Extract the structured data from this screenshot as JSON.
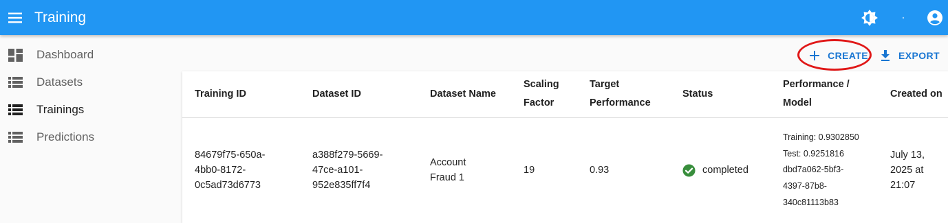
{
  "appbar": {
    "title": "Training",
    "icons": [
      "menu-icon",
      "brightness-icon",
      "more-icon",
      "account-circle-icon"
    ],
    "color": "#2196f3"
  },
  "sidebar": {
    "items": [
      {
        "label": "Dashboard",
        "icon": "dashboard-icon"
      },
      {
        "label": "Datasets",
        "icon": "list-icon"
      },
      {
        "label": "Trainings",
        "icon": "list-icon",
        "active": true
      },
      {
        "label": "Predictions",
        "icon": "list-icon"
      }
    ]
  },
  "actions": {
    "create_label": "CREATE",
    "export_label": "EXPORT",
    "accent_color": "#1976d2",
    "annotation_color": "#e01818"
  },
  "table": {
    "columns": [
      "Training ID",
      "Dataset ID",
      "Dataset Name",
      "Scaling Factor",
      "Target Performance",
      "Status",
      "Performance / Model",
      "Created on"
    ],
    "rows": [
      {
        "training_id": "84679f75-650a-4bb0-8172-0c5ad73d6773",
        "dataset_id": "a388f279-5669-47ce-a101-952e835ff7f4",
        "dataset_name": "Account Fraud 1",
        "scaling_factor": "19",
        "target_performance": "0.93",
        "status": "completed",
        "status_color": "#388e3c",
        "performance_model": "Training: 0.9302850 Test: 0.9251816 dbd7a062-5bf3-4397-87b8-340c81113b83",
        "created_on": "July 13, 2025 at 21:07"
      }
    ]
  }
}
